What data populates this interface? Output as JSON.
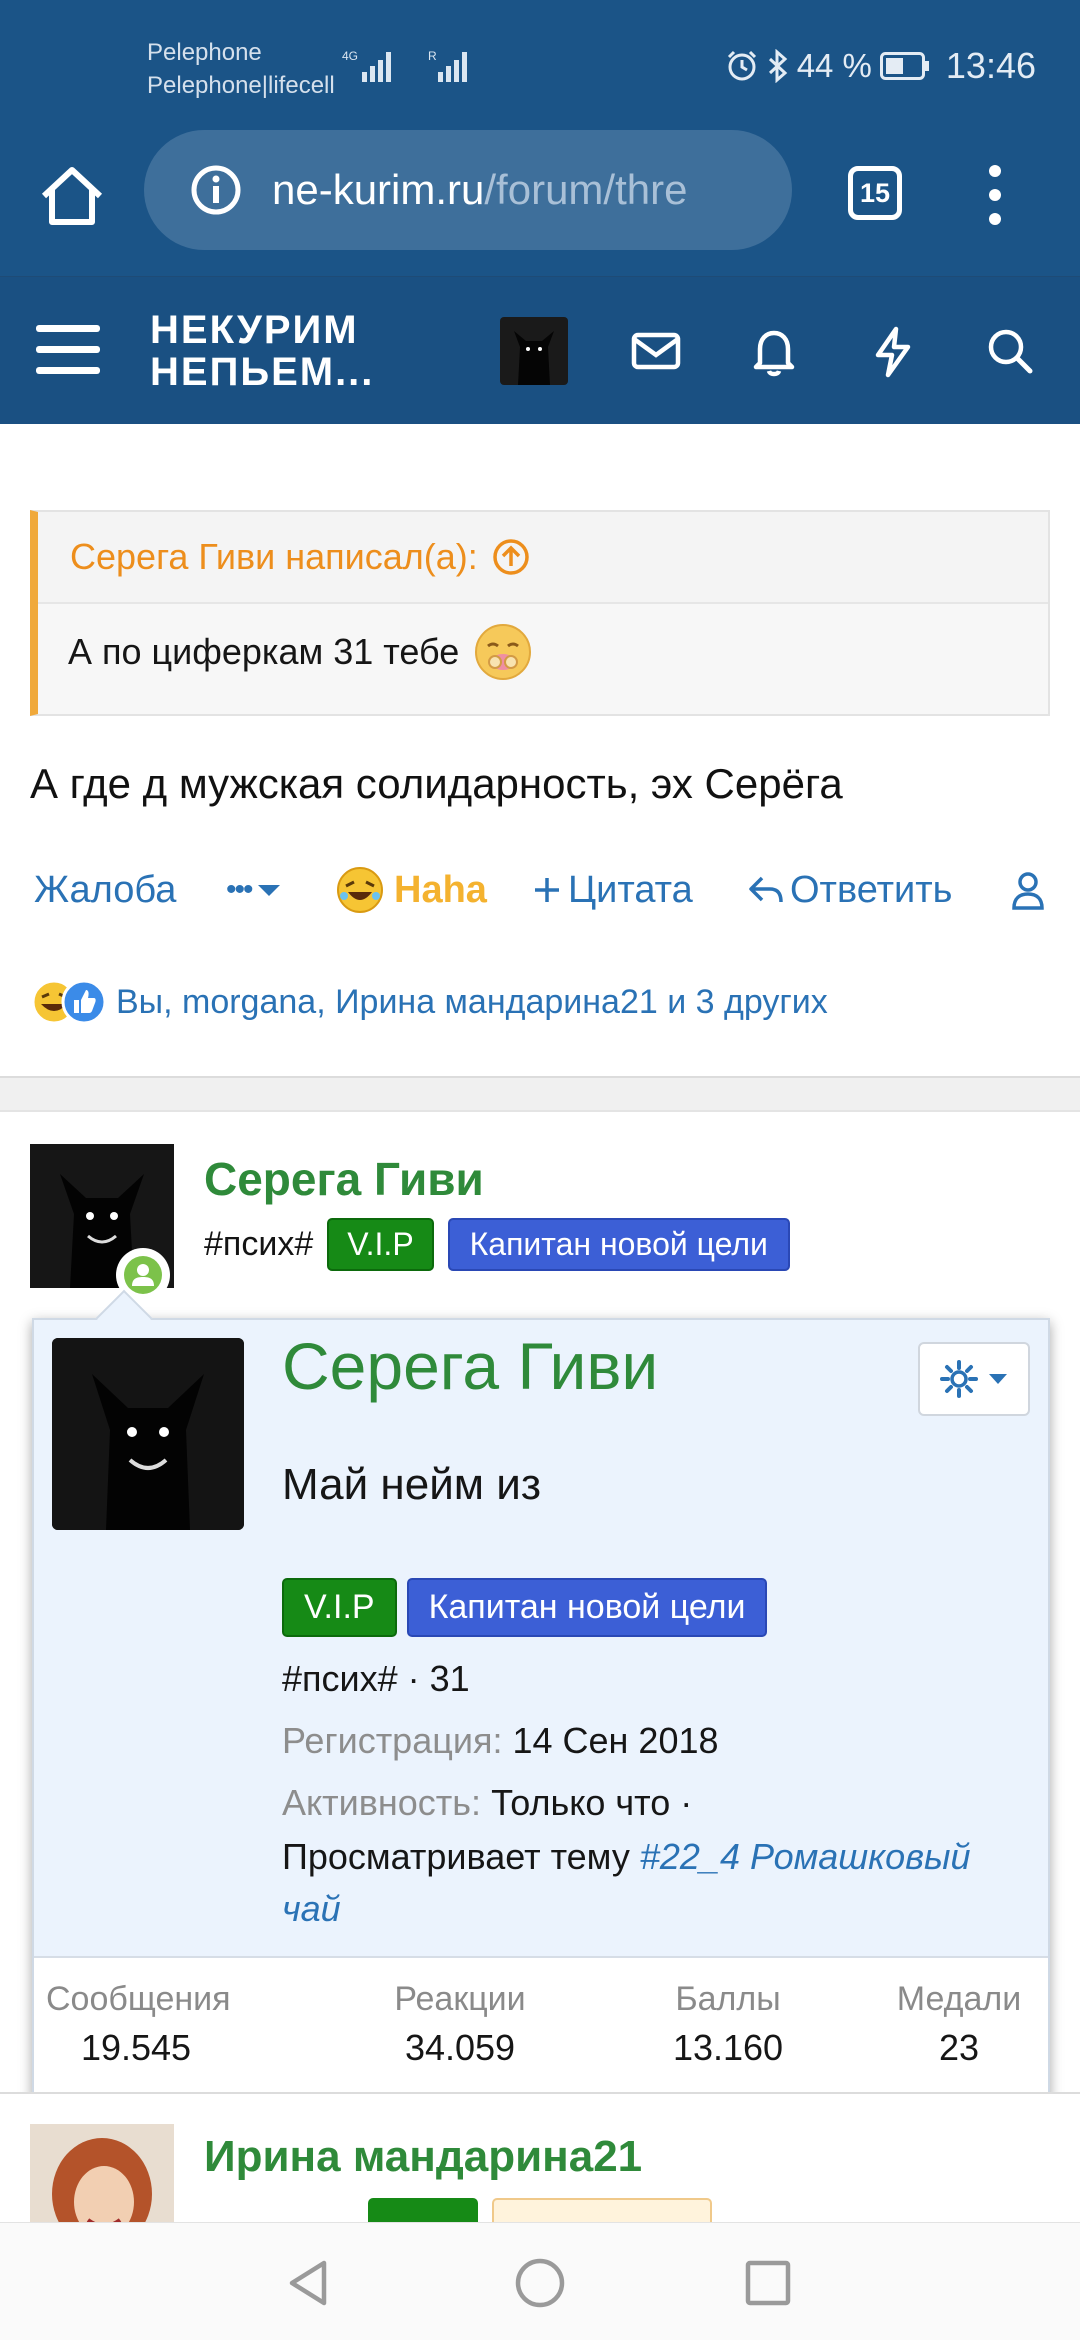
{
  "status_bar": {
    "carrier_1": "Pelephone",
    "carrier_2": "Pelephone|lifecell",
    "network_type": "4G",
    "battery": "44 %",
    "time": "13:46"
  },
  "browser": {
    "url_host": "ne-kurim.ru",
    "url_path": "/forum/thre",
    "tab_count": "15"
  },
  "site": {
    "logo_line1": "НЕКУРИМ",
    "logo_line2": "НЕПЬЕМ..."
  },
  "quote": {
    "header": "Серега Гиви написал(а):",
    "body": "А по циферкам 31 тебе"
  },
  "post": {
    "text": "А где д мужская солидарность, эх Серёга"
  },
  "actions": {
    "report": "Жалоба",
    "more": "•••",
    "reaction": "Haha",
    "quote": "Цитата",
    "reply": "Ответить"
  },
  "reactions_summary": "Вы, morgana, Ирина мандарина21 и 3 других",
  "author": {
    "name": "Серега Гиви",
    "tag": "#псих#",
    "badge_vip": "V.I.P",
    "badge_title": "Капитан новой цели"
  },
  "member_card": {
    "name": "Серега Гиви",
    "title": "Май нейм из",
    "badge_vip": "V.I.P",
    "badge_title": "Капитан новой цели",
    "tag_line": "#псих# · 31",
    "registered_label": "Регистрация:",
    "registered_value": "14 Сен 2018",
    "activity_label": "Активность:",
    "activity_value": "Только что ·",
    "activity_line2": "Просматривает тему",
    "activity_link": "#22_4 Ромашковый",
    "activity_link2": "чай",
    "stats": [
      {
        "label": "Сообщения",
        "value": "19.545"
      },
      {
        "label": "Реакции",
        "value": "34.059"
      },
      {
        "label": "Баллы",
        "value": "13.160"
      },
      {
        "label": "Медали",
        "value": "23"
      }
    ]
  },
  "next_post": {
    "name": "Ирина мандарина21"
  },
  "colors": {
    "header_blue": "#1b5487",
    "link_blue": "#2a72b5",
    "username_green": "#2f8a3a",
    "quote_orange": "#ed8e1c",
    "vip_green": "#168a16",
    "captain_blue": "#3c5fd6"
  }
}
